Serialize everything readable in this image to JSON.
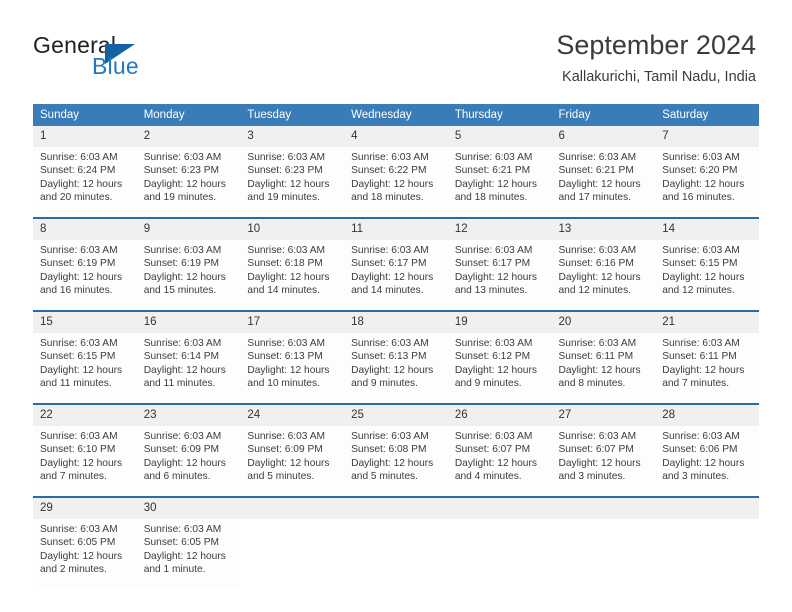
{
  "brand": {
    "name_part1": "General",
    "name_part2": "Blue",
    "triangle_color": "#1462a5",
    "blue_color": "#1f7ac6"
  },
  "header": {
    "month_title": "September 2024",
    "location": "Kallakurichi, Tamil Nadu, India",
    "header_bg": "#3a7cb8",
    "daynum_bg": "#f0f0f0",
    "separator_color": "#2a6ca8"
  },
  "weekdays": [
    "Sunday",
    "Monday",
    "Tuesday",
    "Wednesday",
    "Thursday",
    "Friday",
    "Saturday"
  ],
  "weeks": [
    {
      "days": [
        {
          "num": "1",
          "sunrise": "Sunrise: 6:03 AM",
          "sunset": "Sunset: 6:24 PM",
          "daylight1": "Daylight: 12 hours",
          "daylight2": "and 20 minutes."
        },
        {
          "num": "2",
          "sunrise": "Sunrise: 6:03 AM",
          "sunset": "Sunset: 6:23 PM",
          "daylight1": "Daylight: 12 hours",
          "daylight2": "and 19 minutes."
        },
        {
          "num": "3",
          "sunrise": "Sunrise: 6:03 AM",
          "sunset": "Sunset: 6:23 PM",
          "daylight1": "Daylight: 12 hours",
          "daylight2": "and 19 minutes."
        },
        {
          "num": "4",
          "sunrise": "Sunrise: 6:03 AM",
          "sunset": "Sunset: 6:22 PM",
          "daylight1": "Daylight: 12 hours",
          "daylight2": "and 18 minutes."
        },
        {
          "num": "5",
          "sunrise": "Sunrise: 6:03 AM",
          "sunset": "Sunset: 6:21 PM",
          "daylight1": "Daylight: 12 hours",
          "daylight2": "and 18 minutes."
        },
        {
          "num": "6",
          "sunrise": "Sunrise: 6:03 AM",
          "sunset": "Sunset: 6:21 PM",
          "daylight1": "Daylight: 12 hours",
          "daylight2": "and 17 minutes."
        },
        {
          "num": "7",
          "sunrise": "Sunrise: 6:03 AM",
          "sunset": "Sunset: 6:20 PM",
          "daylight1": "Daylight: 12 hours",
          "daylight2": "and 16 minutes."
        }
      ]
    },
    {
      "days": [
        {
          "num": "8",
          "sunrise": "Sunrise: 6:03 AM",
          "sunset": "Sunset: 6:19 PM",
          "daylight1": "Daylight: 12 hours",
          "daylight2": "and 16 minutes."
        },
        {
          "num": "9",
          "sunrise": "Sunrise: 6:03 AM",
          "sunset": "Sunset: 6:19 PM",
          "daylight1": "Daylight: 12 hours",
          "daylight2": "and 15 minutes."
        },
        {
          "num": "10",
          "sunrise": "Sunrise: 6:03 AM",
          "sunset": "Sunset: 6:18 PM",
          "daylight1": "Daylight: 12 hours",
          "daylight2": "and 14 minutes."
        },
        {
          "num": "11",
          "sunrise": "Sunrise: 6:03 AM",
          "sunset": "Sunset: 6:17 PM",
          "daylight1": "Daylight: 12 hours",
          "daylight2": "and 14 minutes."
        },
        {
          "num": "12",
          "sunrise": "Sunrise: 6:03 AM",
          "sunset": "Sunset: 6:17 PM",
          "daylight1": "Daylight: 12 hours",
          "daylight2": "and 13 minutes."
        },
        {
          "num": "13",
          "sunrise": "Sunrise: 6:03 AM",
          "sunset": "Sunset: 6:16 PM",
          "daylight1": "Daylight: 12 hours",
          "daylight2": "and 12 minutes."
        },
        {
          "num": "14",
          "sunrise": "Sunrise: 6:03 AM",
          "sunset": "Sunset: 6:15 PM",
          "daylight1": "Daylight: 12 hours",
          "daylight2": "and 12 minutes."
        }
      ]
    },
    {
      "days": [
        {
          "num": "15",
          "sunrise": "Sunrise: 6:03 AM",
          "sunset": "Sunset: 6:15 PM",
          "daylight1": "Daylight: 12 hours",
          "daylight2": "and 11 minutes."
        },
        {
          "num": "16",
          "sunrise": "Sunrise: 6:03 AM",
          "sunset": "Sunset: 6:14 PM",
          "daylight1": "Daylight: 12 hours",
          "daylight2": "and 11 minutes."
        },
        {
          "num": "17",
          "sunrise": "Sunrise: 6:03 AM",
          "sunset": "Sunset: 6:13 PM",
          "daylight1": "Daylight: 12 hours",
          "daylight2": "and 10 minutes."
        },
        {
          "num": "18",
          "sunrise": "Sunrise: 6:03 AM",
          "sunset": "Sunset: 6:13 PM",
          "daylight1": "Daylight: 12 hours",
          "daylight2": "and 9 minutes."
        },
        {
          "num": "19",
          "sunrise": "Sunrise: 6:03 AM",
          "sunset": "Sunset: 6:12 PM",
          "daylight1": "Daylight: 12 hours",
          "daylight2": "and 9 minutes."
        },
        {
          "num": "20",
          "sunrise": "Sunrise: 6:03 AM",
          "sunset": "Sunset: 6:11 PM",
          "daylight1": "Daylight: 12 hours",
          "daylight2": "and 8 minutes."
        },
        {
          "num": "21",
          "sunrise": "Sunrise: 6:03 AM",
          "sunset": "Sunset: 6:11 PM",
          "daylight1": "Daylight: 12 hours",
          "daylight2": "and 7 minutes."
        }
      ]
    },
    {
      "days": [
        {
          "num": "22",
          "sunrise": "Sunrise: 6:03 AM",
          "sunset": "Sunset: 6:10 PM",
          "daylight1": "Daylight: 12 hours",
          "daylight2": "and 7 minutes."
        },
        {
          "num": "23",
          "sunrise": "Sunrise: 6:03 AM",
          "sunset": "Sunset: 6:09 PM",
          "daylight1": "Daylight: 12 hours",
          "daylight2": "and 6 minutes."
        },
        {
          "num": "24",
          "sunrise": "Sunrise: 6:03 AM",
          "sunset": "Sunset: 6:09 PM",
          "daylight1": "Daylight: 12 hours",
          "daylight2": "and 5 minutes."
        },
        {
          "num": "25",
          "sunrise": "Sunrise: 6:03 AM",
          "sunset": "Sunset: 6:08 PM",
          "daylight1": "Daylight: 12 hours",
          "daylight2": "and 5 minutes."
        },
        {
          "num": "26",
          "sunrise": "Sunrise: 6:03 AM",
          "sunset": "Sunset: 6:07 PM",
          "daylight1": "Daylight: 12 hours",
          "daylight2": "and 4 minutes."
        },
        {
          "num": "27",
          "sunrise": "Sunrise: 6:03 AM",
          "sunset": "Sunset: 6:07 PM",
          "daylight1": "Daylight: 12 hours",
          "daylight2": "and 3 minutes."
        },
        {
          "num": "28",
          "sunrise": "Sunrise: 6:03 AM",
          "sunset": "Sunset: 6:06 PM",
          "daylight1": "Daylight: 12 hours",
          "daylight2": "and 3 minutes."
        }
      ]
    },
    {
      "days": [
        {
          "num": "29",
          "sunrise": "Sunrise: 6:03 AM",
          "sunset": "Sunset: 6:05 PM",
          "daylight1": "Daylight: 12 hours",
          "daylight2": "and 2 minutes."
        },
        {
          "num": "30",
          "sunrise": "Sunrise: 6:03 AM",
          "sunset": "Sunset: 6:05 PM",
          "daylight1": "Daylight: 12 hours",
          "daylight2": "and 1 minute."
        },
        {
          "num": "",
          "sunrise": "",
          "sunset": "",
          "daylight1": "",
          "daylight2": ""
        },
        {
          "num": "",
          "sunrise": "",
          "sunset": "",
          "daylight1": "",
          "daylight2": ""
        },
        {
          "num": "",
          "sunrise": "",
          "sunset": "",
          "daylight1": "",
          "daylight2": ""
        },
        {
          "num": "",
          "sunrise": "",
          "sunset": "",
          "daylight1": "",
          "daylight2": ""
        },
        {
          "num": "",
          "sunrise": "",
          "sunset": "",
          "daylight1": "",
          "daylight2": ""
        }
      ]
    }
  ]
}
